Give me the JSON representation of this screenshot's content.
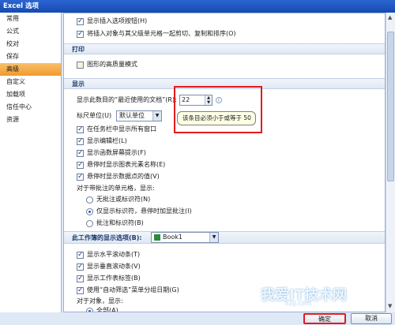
{
  "window": {
    "title": "Excel 选项"
  },
  "sidebar": {
    "items": [
      {
        "label": "常用"
      },
      {
        "label": "公式"
      },
      {
        "label": "校对"
      },
      {
        "label": "保存"
      },
      {
        "label": "高级",
        "active": true
      },
      {
        "label": "自定义"
      },
      {
        "label": "加载项"
      },
      {
        "label": "信任中心"
      },
      {
        "label": "资源"
      }
    ]
  },
  "main": {
    "top_rows": [
      {
        "label": "显示插入选项按钮(H)",
        "checked": true
      },
      {
        "label": "将插入对象与其父级单元格一起剪切、复制和排序(O)",
        "checked": true
      }
    ],
    "print_section": {
      "title": "打印"
    },
    "print_rows": [
      {
        "label": "图形的高质量模式",
        "checked": false
      }
    ],
    "display_section": {
      "title": "显示"
    },
    "recent_docs": {
      "label": "显示此数目的“最近使用的文档”(R):",
      "value": "22"
    },
    "ruler_units": {
      "label": "标尺单位(U)",
      "value": "默认单位"
    },
    "tooltip": {
      "text": "该条目必须小于或等于 50"
    },
    "display_rows": [
      {
        "label": "在任务栏中显示所有窗口",
        "checked": true
      },
      {
        "label": "显示编辑栏(L)",
        "checked": true
      },
      {
        "label": "显示函数屏幕提示(F)",
        "checked": true
      },
      {
        "label": "悬停时显示图表元素名称(E)",
        "checked": true
      },
      {
        "label": "悬停时显示数据点的值(V)",
        "checked": true
      }
    ],
    "comment_group": {
      "label": "对于带批注的单元格，显示:",
      "options": [
        {
          "label": "无批注或标识符(N)",
          "selected": false
        },
        {
          "label": "仅显示标识符，悬停时加显批注(I)",
          "selected": true
        },
        {
          "label": "批注和标识符(B)",
          "selected": false
        }
      ]
    },
    "workbook_section": {
      "title": "此工作簿的显示选项(B):",
      "workbook": "Book1"
    },
    "workbook_rows": [
      {
        "label": "显示水平滚动条(T)",
        "checked": true
      },
      {
        "label": "显示垂直滚动条(V)",
        "checked": true
      },
      {
        "label": "显示工作表标签(B)",
        "checked": true
      },
      {
        "label": "使用“自动筛选”菜单分组日期(G)",
        "checked": true
      }
    ],
    "objects_label": "对于对象，显示:",
    "objects_option": "全部(A)"
  },
  "footer": {
    "ok_label": "确定",
    "cancel_label": "取消"
  },
  "watermark": {
    "text": "我爱IT技术网",
    "url": "52ij.com"
  },
  "colors": {
    "accent": "#f19a2c",
    "highlight": "#e21b1b",
    "title_bar": "#164bb0"
  }
}
